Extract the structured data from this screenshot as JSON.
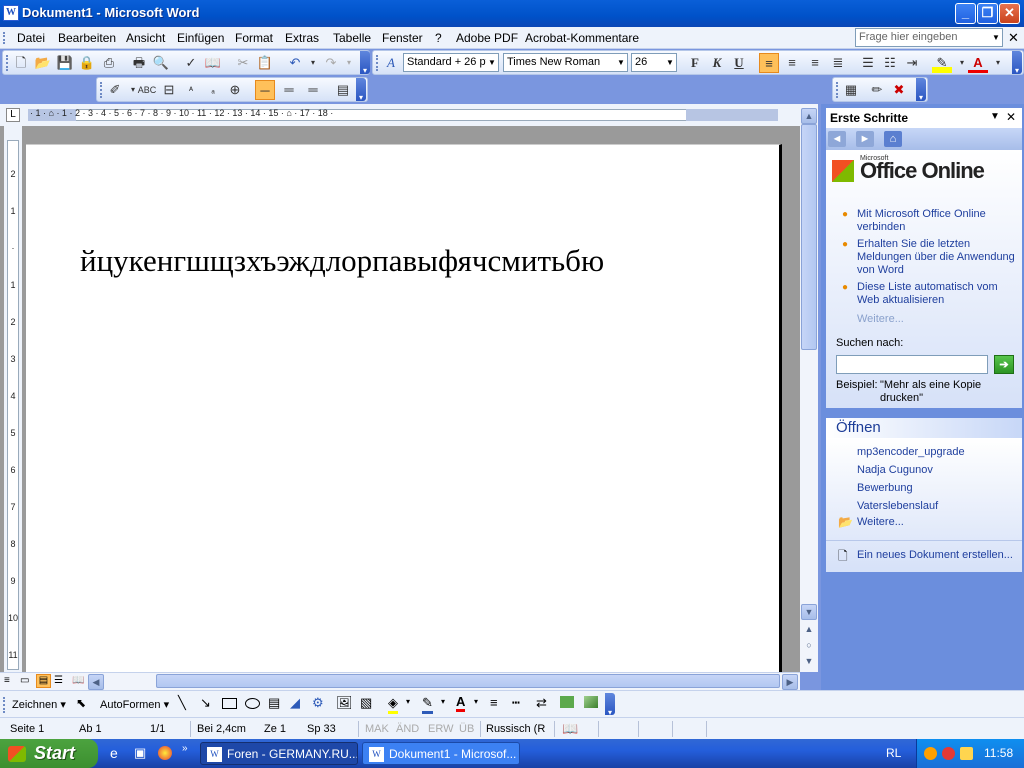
{
  "window": {
    "title": "Dokument1 - Microsoft Word"
  },
  "menubar": {
    "items": [
      "Datei",
      "Bearbeiten",
      "Ansicht",
      "Einfügen",
      "Format",
      "Extras",
      "Tabelle",
      "Fenster",
      "?",
      "Adobe PDF",
      "Acrobat-Kommentare"
    ],
    "help_placeholder": "Frage hier eingeben"
  },
  "formatting": {
    "style": "Standard + 26 pt",
    "font": "Times New Roman",
    "size": "26"
  },
  "ruler": {
    "numbers": "· 1 · ⌂ · 1 · 2 · 3 · 4 · 5 · 6 · 7 · 8 · 9 · 10 · 11 · 12 · 13 · 14 · 15 · ⌂ · 17 · 18 ·"
  },
  "vruler": {
    "numbers": [
      "2",
      "1",
      "·",
      "1",
      "2",
      "3",
      "4",
      "5",
      "6",
      "7",
      "8",
      "9",
      "10",
      "11"
    ]
  },
  "document": {
    "text": "йцукенгшщзхъэждлорпавыфячсмитьбю"
  },
  "task_pane": {
    "title": "Erste Schritte",
    "logo": "Office Online",
    "logo_small": "Microsoft",
    "links": [
      "Mit Microsoft Office Online verbinden",
      "Erhalten Sie die letzten Meldungen über die Anwendung von Word",
      "Diese Liste automatisch vom Web aktualisieren"
    ],
    "more": "Weitere...",
    "search_label": "Suchen nach:",
    "example_label": "Beispiel:",
    "example_value": "\"Mehr als eine Kopie drucken\"",
    "open_title": "Öffnen",
    "recent": [
      "mp3encoder_upgrade",
      "Nadja Cugunov",
      "Bewerbung",
      "Vaterslebenslauf"
    ],
    "open_more": "Weitere...",
    "new_doc": "Ein neues Dokument erstellen..."
  },
  "drawbar": {
    "draw": "Zeichnen",
    "autoshapes": "AutoFormen"
  },
  "status": {
    "page": "Seite  1",
    "section": "Ab  1",
    "pages": "1/1",
    "at": "Bei  2,4cm",
    "line": "Ze  1",
    "col": "Sp  33",
    "mak": "MAK",
    "aend": "ÄND",
    "erw": "ERW",
    "ueb": "ÜB",
    "lang": "Russisch (R"
  },
  "taskbar": {
    "start": "Start",
    "tasks": [
      "Foren - GERMANY.RU...",
      "Dokument1 - Microsof..."
    ],
    "lang": "RL",
    "time": "11:58"
  }
}
